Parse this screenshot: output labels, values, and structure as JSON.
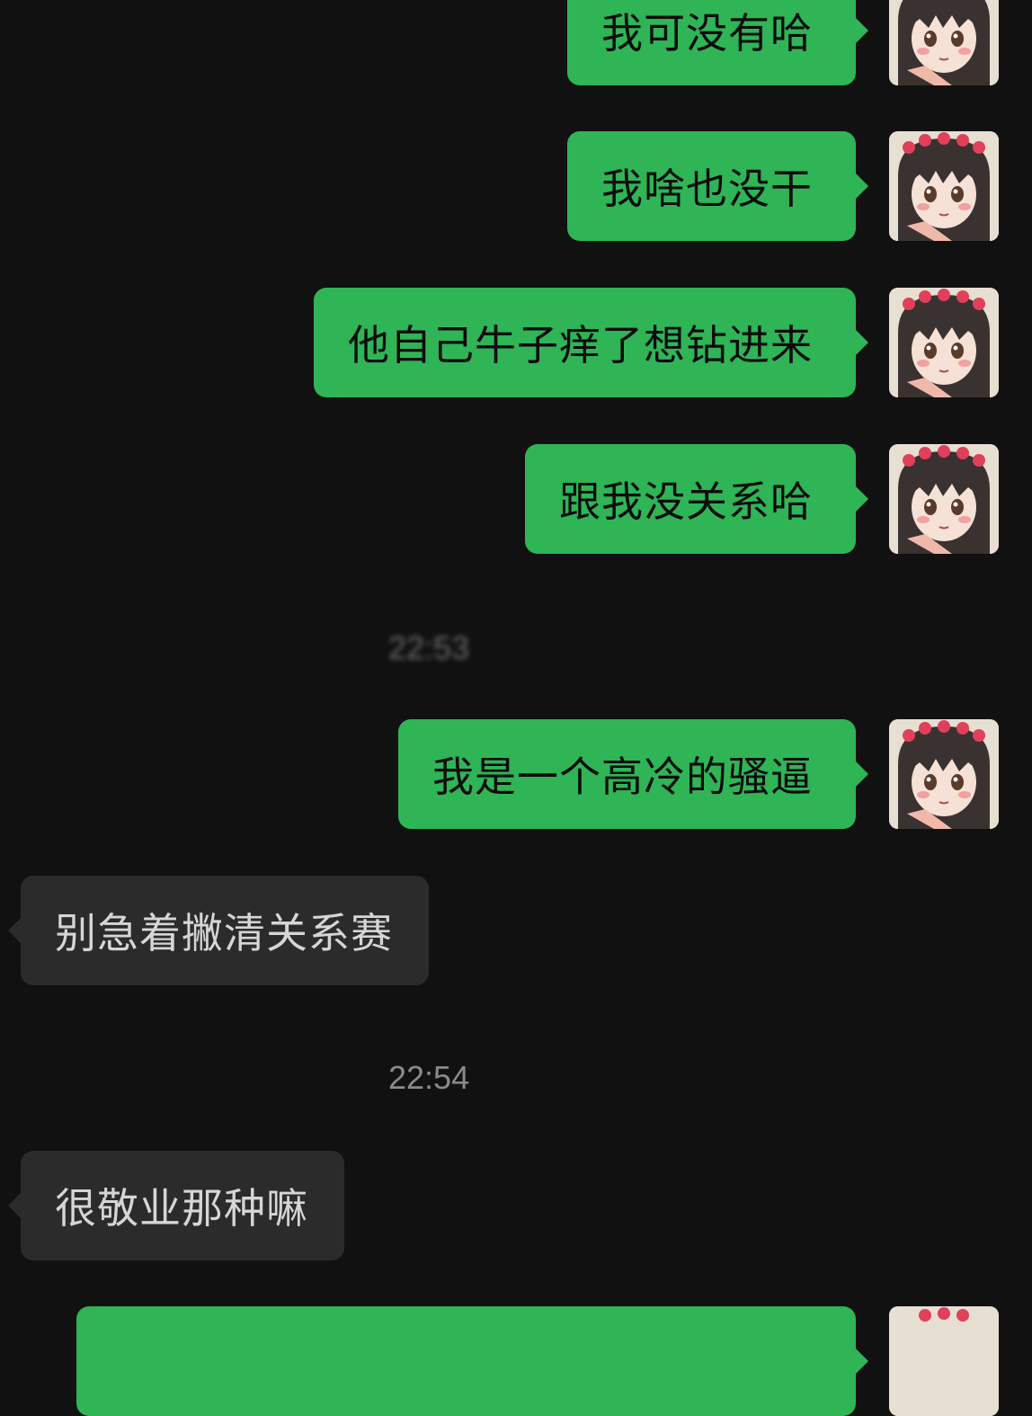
{
  "messages": [
    {
      "direction": "outgoing",
      "text": "我可没有哈"
    },
    {
      "direction": "outgoing",
      "text": "我啥也没干"
    },
    {
      "direction": "outgoing",
      "text": "他自己牛子痒了想钻进来"
    },
    {
      "direction": "outgoing",
      "text": "跟我没关系哈"
    },
    {
      "direction": "outgoing",
      "text": "我是一个高冷的骚逼"
    },
    {
      "direction": "incoming",
      "text": "别急着撇清关系赛"
    },
    {
      "direction": "incoming",
      "text": "很敬业那种嘛"
    }
  ],
  "timestamps": {
    "blurred": "22:53",
    "second": "22:54"
  },
  "colors": {
    "background": "#111111",
    "outgoing_bubble": "#2fb456",
    "incoming_bubble": "#2b2b2b",
    "timestamp_text": "#8a8a8a"
  },
  "avatar": {
    "icon": "anime-girl-avatar-icon"
  }
}
